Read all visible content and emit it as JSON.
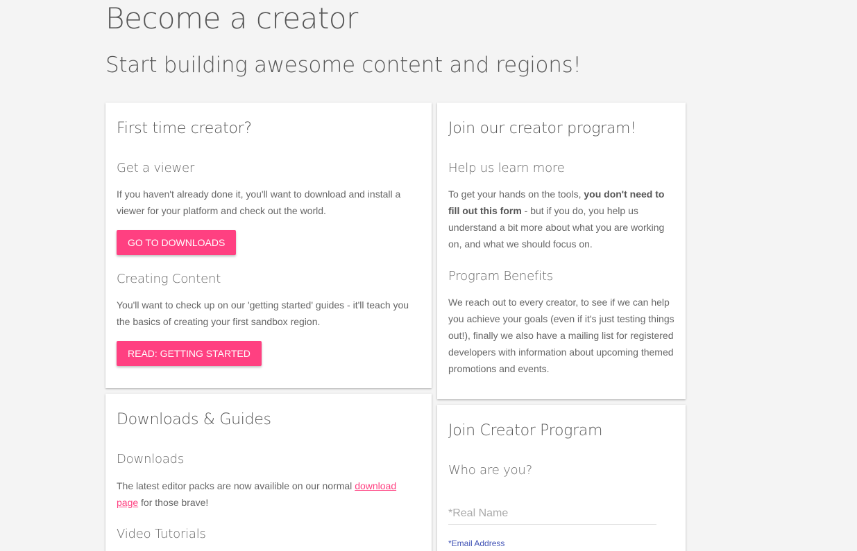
{
  "header": {
    "title": "Become a creator",
    "subtitle": "Start building awesome content and regions!"
  },
  "first_time": {
    "title": "First time creator?",
    "viewer_heading": "Get a viewer",
    "viewer_text": "If you haven't already done it, you'll want to download and install a viewer for your platform and check out the world.",
    "downloads_button": "Go to Downloads",
    "content_heading": "Creating Content",
    "content_text": "You'll want to check up on our 'getting started' guides - it'll teach you the basics of creating your first sandbox region.",
    "getting_started_button": "Read: Getting Started"
  },
  "program": {
    "title": "Join our creator program!",
    "learn_heading": "Help us learn more",
    "learn_text_before": "To get your hands on the tools, ",
    "learn_text_bold": "you don't need to fill out this form",
    "learn_text_after": " - but if you do, you help us understand a bit more about what you are working on, and what we should focus on.",
    "benefits_heading": "Program Benefits",
    "benefits_text": "We reach out to every creator, to see if we can help you achieve your goals (even if it's just testing things out!), finally we also have a mailing list for registered developers with information about upcoming themed promotions and events."
  },
  "downloads": {
    "title": "Downloads & Guides",
    "downloads_heading": "Downloads",
    "downloads_text_before": "The latest editor packs are now availible on our normal ",
    "downloads_link": "download page",
    "downloads_text_after": " for those brave!",
    "video_heading": "Video Tutorials"
  },
  "join_form": {
    "title": "Join Creator Program",
    "who_heading": "Who are you?",
    "real_name_placeholder": "*Real Name",
    "email_label": "*Email Address"
  },
  "colors": {
    "accent": "#ff4081",
    "label": "#3f51b5",
    "background": "#f4f4f4"
  }
}
